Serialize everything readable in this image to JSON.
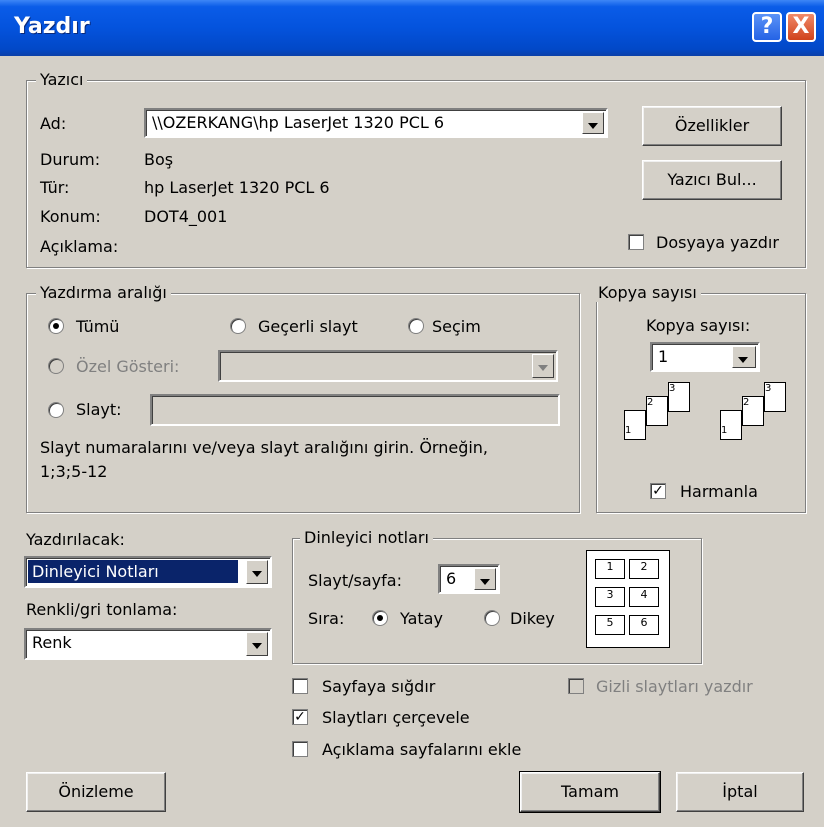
{
  "window": {
    "title": "Yazdır",
    "help": "?",
    "close": "X"
  },
  "printer": {
    "legend": "Yazıcı",
    "name_label": "Ad:",
    "name_value": "\\\\OZERKANG\\hp LaserJet 1320 PCL 6",
    "status_label": "Durum:",
    "status_value": "Boş",
    "type_label": "Tür:",
    "type_value": "hp LaserJet 1320 PCL 6",
    "location_label": "Konum:",
    "location_value": "DOT4_001",
    "comment_label": "Açıklama:",
    "properties_button": "Özellikler",
    "find_button": "Yazıcı Bul...",
    "print_to_file": "Dosyaya yazdır"
  },
  "range": {
    "legend": "Yazdırma aralığı",
    "all": "Tümü",
    "current": "Geçerli slayt",
    "selection": "Seçim",
    "custom_show": "Özel Gösteri:",
    "slides": "Slayt:",
    "hint": "Slayt numaralarını ve/veya slayt aralığını girin. Örneğin,",
    "hint2": "1;3;5-12"
  },
  "copies": {
    "legend": "Kopya sayısı",
    "label": "Kopya sayısı:",
    "value": "1",
    "collate": "Harmanla"
  },
  "print_what": {
    "label": "Yazdırılacak:",
    "value": "Dinleyici Notları"
  },
  "color": {
    "label": "Renkli/gri tonlama:",
    "value": "Renk"
  },
  "handouts": {
    "legend": "Dinleyici notları",
    "per_page_label": "Slayt/sayfa:",
    "per_page_value": "6",
    "order_label": "Sıra:",
    "horizontal": "Yatay",
    "vertical": "Dikey",
    "preview_numbers": [
      "1",
      "2",
      "3",
      "4",
      "5",
      "6"
    ]
  },
  "options": {
    "fit": "Sayfaya sığdır",
    "frame": "Slaytları çerçevele",
    "comments": "Açıklama sayfalarını ekle",
    "hidden": "Gizli slaytları yazdır"
  },
  "buttons": {
    "preview": "Önizleme",
    "ok": "Tamam",
    "cancel": "İptal"
  }
}
